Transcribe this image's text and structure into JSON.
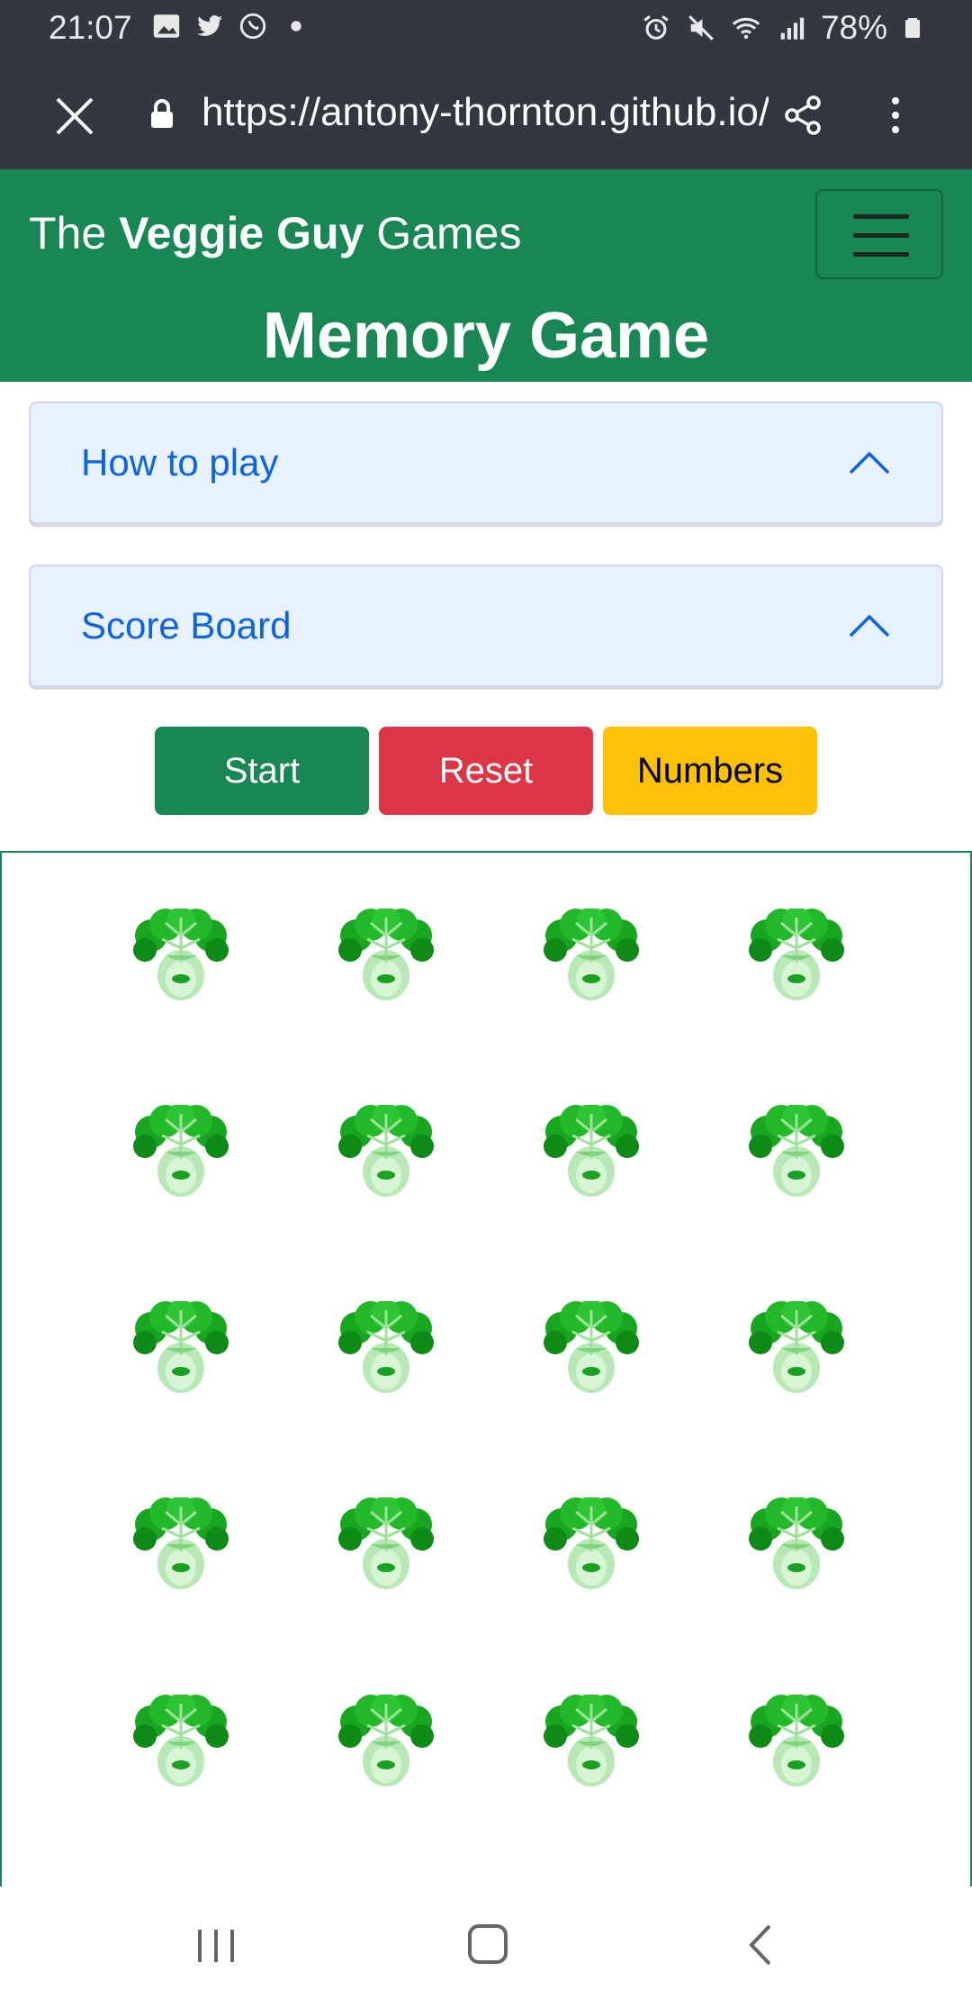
{
  "status_bar": {
    "time": "21:07",
    "battery": "78%",
    "left_icons": [
      "gallery-icon",
      "twitter-icon",
      "whatsapp-icon",
      "dot-icon"
    ],
    "right_icons": [
      "alarm-icon",
      "mute-icon",
      "wifi-icon",
      "signal-icon",
      "battery-icon"
    ]
  },
  "browser": {
    "url": "https://antony-thornton.github.io/"
  },
  "navbar": {
    "brand_prefix": "The ",
    "brand_bold": "Veggie Guy",
    "brand_suffix": " Games",
    "title": "Memory Game"
  },
  "accordion": {
    "how_to_play": "How to play",
    "score_board": "Score Board"
  },
  "controls": {
    "start": "Start",
    "reset": "Reset",
    "numbers": "Numbers"
  },
  "board": {
    "rows": 5,
    "cols": 4,
    "card_icon": "bok-choy-icon"
  },
  "colors": {
    "brand_green": "#198754",
    "danger_red": "#dc3545",
    "warning_yellow": "#ffc107",
    "accordion_bg": "#e7f1ff",
    "accordion_text": "#0c63e4",
    "system_bar": "#33373f"
  }
}
